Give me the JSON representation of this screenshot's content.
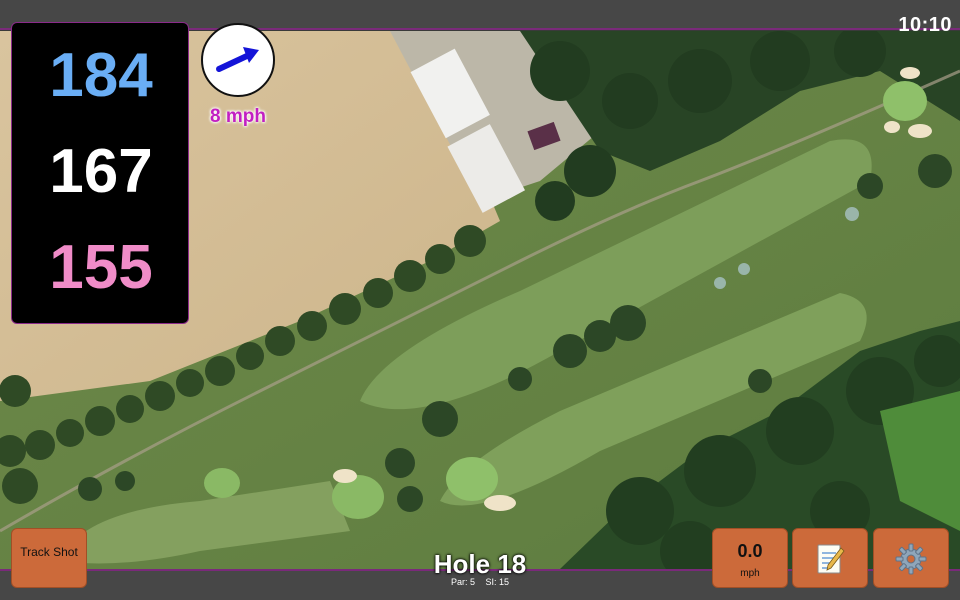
{
  "clock": "10:10",
  "distances": {
    "back": "184",
    "middle": "167",
    "front": "155"
  },
  "wind": {
    "speed": "8 mph",
    "direction_icon": "arrow-right-up-icon"
  },
  "hole": {
    "title": "Hole 18",
    "par": "Par: 5",
    "stroke_index": "SI: 15"
  },
  "buttons": {
    "track_shot": "Track Shot",
    "speed_value": "0.0",
    "speed_unit": "mph",
    "notes_icon": "notepad-icon",
    "settings_icon": "gear-icon"
  },
  "colors": {
    "back_distance": "#6aaef5",
    "middle_distance": "#ffffff",
    "front_distance": "#f08cc8",
    "wind_text": "#c21fc2",
    "button": "#cc6a3a",
    "accent_border": "#7a2a7a"
  }
}
